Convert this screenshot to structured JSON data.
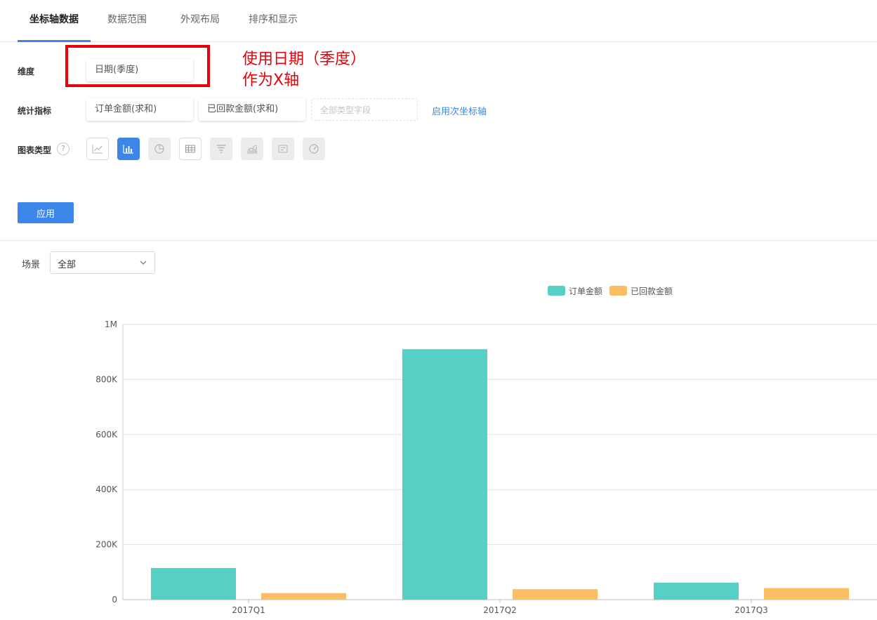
{
  "tabs": [
    {
      "label": "坐标轴数据",
      "active": true
    },
    {
      "label": "数据范围",
      "active": false
    },
    {
      "label": "外观布局",
      "active": false
    },
    {
      "label": "排序和显示",
      "active": false
    }
  ],
  "config": {
    "dimension_label": "维度",
    "dimension_value": "日期(季度)",
    "metrics_label": "统计指标",
    "metrics": [
      "订单金额(求和)",
      "已回款金额(求和)"
    ],
    "metrics_placeholder": "全部类型字段",
    "secondary_axis_link": "启用次坐标轴",
    "chart_type_label": "图表类型",
    "help_glyph": "?",
    "chart_types": [
      {
        "icon": "line-chart-icon",
        "selected": false
      },
      {
        "icon": "bar-chart-icon",
        "selected": true
      },
      {
        "icon": "pie-chart-icon",
        "selected": false
      },
      {
        "icon": "table-icon",
        "selected": false
      },
      {
        "icon": "funnel-icon",
        "selected": false
      },
      {
        "icon": "area-chart-icon",
        "selected": false
      },
      {
        "icon": "text-card-icon",
        "selected": false
      },
      {
        "icon": "gauge-icon",
        "selected": false
      }
    ],
    "apply_label": "应用"
  },
  "annotation": {
    "line1": "使用日期（季度）",
    "line2": "作为X轴",
    "color": "#e8000b"
  },
  "filter": {
    "scene_label": "场景",
    "scene_value": "全部"
  },
  "colors": {
    "accent": "#3b86e8",
    "series1": "#56d0c5",
    "series2": "#fbbe65"
  },
  "chart_data": {
    "type": "bar",
    "categories": [
      "2017Q1",
      "2017Q2",
      "2017Q3"
    ],
    "series": [
      {
        "name": "订单金额",
        "values": [
          115000,
          910000,
          62000
        ]
      },
      {
        "name": "已回款金额",
        "values": [
          24000,
          38000,
          42000
        ]
      }
    ],
    "ylim": [
      0,
      1000000
    ],
    "yticks": [
      "0",
      "200K",
      "400K",
      "600K",
      "800K",
      "1M"
    ],
    "grid": true,
    "legend_position": "top-center"
  }
}
